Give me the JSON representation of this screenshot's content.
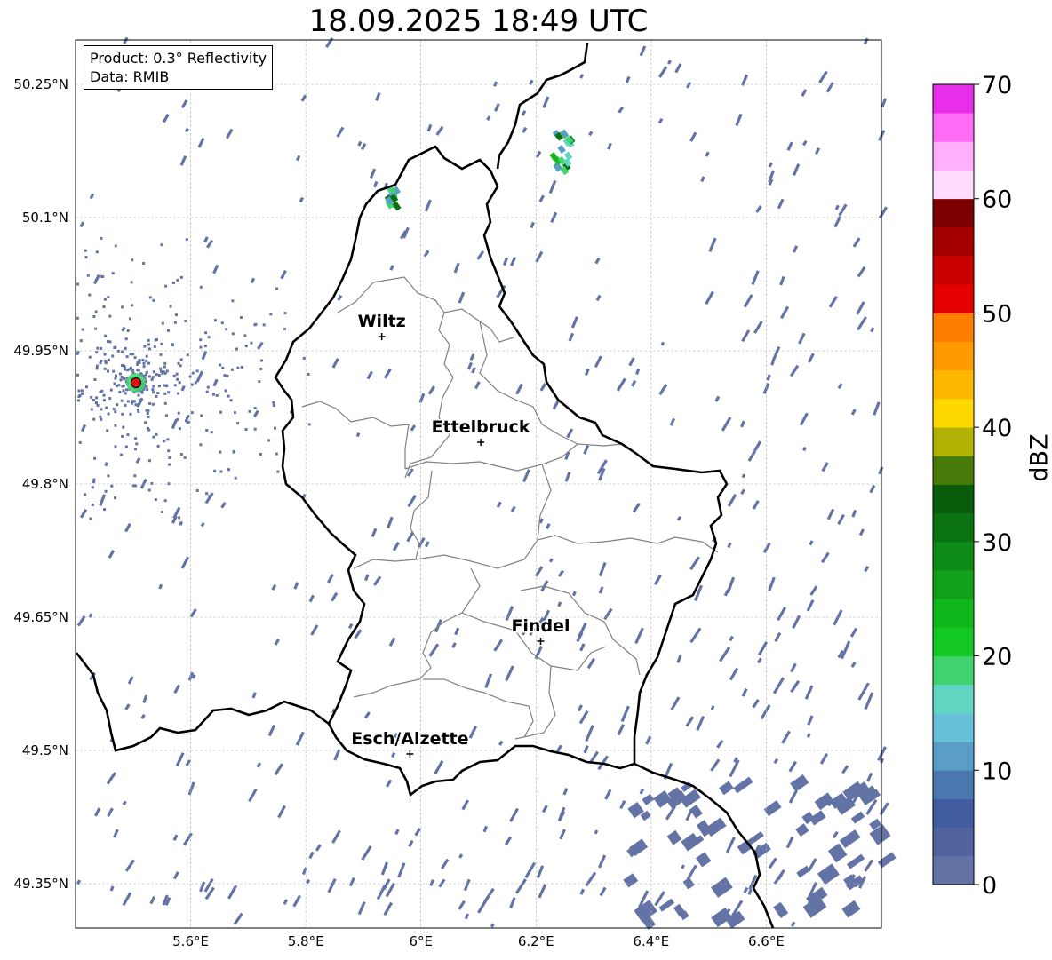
{
  "title": "18.09.2025 18:49 UTC",
  "info_box": {
    "product": "Product: 0.3° Reflectivity",
    "data": "Data: RMIB"
  },
  "axes": {
    "lon_ticks": [
      {
        "value": 5.6,
        "label": "5.6°E"
      },
      {
        "value": 5.8,
        "label": "5.8°E"
      },
      {
        "value": 6.0,
        "label": "6°E"
      },
      {
        "value": 6.2,
        "label": "6.2°E"
      },
      {
        "value": 6.4,
        "label": "6.4°E"
      },
      {
        "value": 6.6,
        "label": "6.6°E"
      }
    ],
    "lat_ticks": [
      {
        "value": 50.25,
        "label": "50.25°N"
      },
      {
        "value": 50.1,
        "label": "50.1°N"
      },
      {
        "value": 49.95,
        "label": "49.95°N"
      },
      {
        "value": 49.8,
        "label": "49.8°N"
      },
      {
        "value": 49.65,
        "label": "49.65°N"
      },
      {
        "value": 49.5,
        "label": "49.5°N"
      },
      {
        "value": 49.35,
        "label": "49.35°N"
      }
    ],
    "lon_range": [
      5.4,
      6.8
    ],
    "lat_range": [
      49.3,
      50.3
    ],
    "grid": true
  },
  "cities": [
    {
      "name": "Wiltz",
      "lon": 5.932,
      "lat": 49.966
    },
    {
      "name": "Ettelbruck",
      "lon": 6.104,
      "lat": 49.847
    },
    {
      "name": "Findel",
      "lon": 6.208,
      "lat": 49.623
    },
    {
      "name": "Esch/Alzette",
      "lon": 5.981,
      "lat": 49.496
    }
  ],
  "radar_site": {
    "lon": 5.505,
    "lat": 49.914,
    "color": "#e01010"
  },
  "colorbar": {
    "label": "dBZ",
    "min": 0,
    "max": 70,
    "ticks": [
      {
        "value": 0,
        "label": "0"
      },
      {
        "value": 10,
        "label": "10"
      },
      {
        "value": 20,
        "label": "20"
      },
      {
        "value": 30,
        "label": "30"
      },
      {
        "value": 40,
        "label": "40"
      },
      {
        "value": 50,
        "label": "50"
      },
      {
        "value": 60,
        "label": "60"
      },
      {
        "value": 70,
        "label": "70"
      }
    ],
    "colors": [
      "#6473a6",
      "#52649e",
      "#415c9f",
      "#4a79b0",
      "#5a9ec8",
      "#66c1d9",
      "#61d6c3",
      "#3fd46f",
      "#13c823",
      "#11b81c",
      "#10a01a",
      "#0e8a16",
      "#0a7210",
      "#095c0c",
      "#477a08",
      "#b0b304",
      "#ffd800",
      "#ffb800",
      "#ff9a00",
      "#ff7e00",
      "#e40000",
      "#c80000",
      "#a40000",
      "#7c0000",
      "#ffdcfd",
      "#ffb0fc",
      "#ff6cf6",
      "#e830ec"
    ]
  },
  "map_colors": {
    "country_border": "#000000",
    "canton_border": "#808080",
    "grid": "#b0b0b0",
    "echo_low": "#6473a6"
  }
}
